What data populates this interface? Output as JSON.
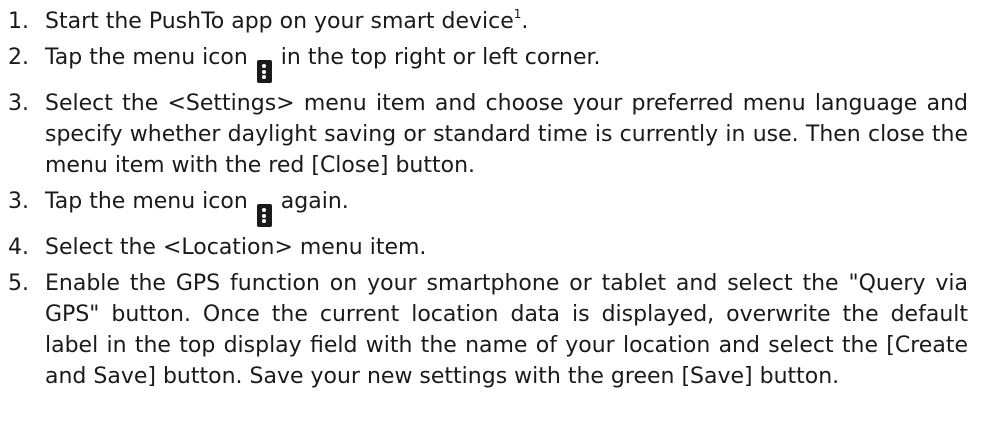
{
  "steps": [
    {
      "num": "1.",
      "before": "Start the PushTo app on your smart device",
      "footnote": "1",
      "after": "."
    },
    {
      "num": "2.",
      "before": "Tap the menu icon ",
      "icon": "menu-icon",
      "after": " in the top right or left corner."
    },
    {
      "num": "3.",
      "text": "Select the <Settings> menu item and choose your preferred menu language and specify whether daylight saving or standard time is currently in use. Then close the menu item with the red [Close] button."
    },
    {
      "num": "3.",
      "before": "Tap the menu icon ",
      "icon": "menu-icon",
      "after": " again."
    },
    {
      "num": "4.",
      "text": "Select the <Location> menu item."
    },
    {
      "num": "5.",
      "text": "Enable the GPS function on your smartphone or tablet and select the \"Query via GPS\" button. Once the current location data is displayed, overwrite the default label in the top display field with the name of your location and select the [Create and Save] button. Save your new settings with the green [Save] button."
    }
  ]
}
